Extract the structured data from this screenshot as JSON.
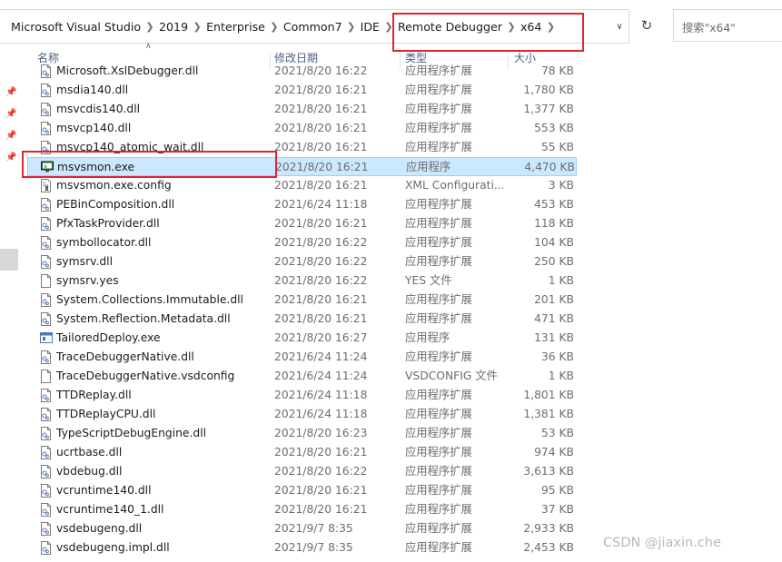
{
  "address": {
    "crumbs": [
      "Microsoft Visual Studio",
      "2019",
      "Enterprise",
      "Common7",
      "IDE",
      "Remote Debugger",
      "x64"
    ]
  },
  "search": {
    "placeholder": "搜索\"x64\""
  },
  "columns": {
    "name": "名称",
    "date": "修改日期",
    "type": "类型",
    "size": "大小"
  },
  "files": [
    {
      "name": "Microsoft.XslDebugger.dll",
      "date": "2021/8/20 16:22",
      "type": "应用程序扩展",
      "size": "78 KB",
      "icon": "dll-icon"
    },
    {
      "name": "msdia140.dll",
      "date": "2021/8/20 16:21",
      "type": "应用程序扩展",
      "size": "1,780 KB",
      "icon": "dll-icon"
    },
    {
      "name": "msvcdis140.dll",
      "date": "2021/8/20 16:21",
      "type": "应用程序扩展",
      "size": "1,377 KB",
      "icon": "dll-icon"
    },
    {
      "name": "msvcp140.dll",
      "date": "2021/8/20 16:21",
      "type": "应用程序扩展",
      "size": "553 KB",
      "icon": "dll-icon"
    },
    {
      "name": "msvcp140_atomic_wait.dll",
      "date": "2021/8/20 16:21",
      "type": "应用程序扩展",
      "size": "55 KB",
      "icon": "dll-icon"
    },
    {
      "name": "msvsmon.exe",
      "date": "2021/8/20 16:21",
      "type": "应用程序",
      "size": "4,470 KB",
      "icon": "monitor-exe-icon",
      "selected": true
    },
    {
      "name": "msvsmon.exe.config",
      "date": "2021/8/20 16:21",
      "type": "XML Configurati...",
      "size": "3 KB",
      "icon": "config-icon"
    },
    {
      "name": "PEBinComposition.dll",
      "date": "2021/6/24 11:18",
      "type": "应用程序扩展",
      "size": "453 KB",
      "icon": "dll-icon"
    },
    {
      "name": "PfxTaskProvider.dll",
      "date": "2021/8/20 16:21",
      "type": "应用程序扩展",
      "size": "118 KB",
      "icon": "dll-icon"
    },
    {
      "name": "symbollocator.dll",
      "date": "2021/8/20 16:22",
      "type": "应用程序扩展",
      "size": "104 KB",
      "icon": "dll-icon"
    },
    {
      "name": "symsrv.dll",
      "date": "2021/8/20 16:22",
      "type": "应用程序扩展",
      "size": "250 KB",
      "icon": "dll-icon"
    },
    {
      "name": "symsrv.yes",
      "date": "2021/8/20 16:22",
      "type": "YES 文件",
      "size": "1 KB",
      "icon": "file-icon"
    },
    {
      "name": "System.Collections.Immutable.dll",
      "date": "2021/8/20 16:21",
      "type": "应用程序扩展",
      "size": "201 KB",
      "icon": "dll-icon"
    },
    {
      "name": "System.Reflection.Metadata.dll",
      "date": "2021/8/20 16:21",
      "type": "应用程序扩展",
      "size": "471 KB",
      "icon": "dll-icon"
    },
    {
      "name": "TailoredDeploy.exe",
      "date": "2021/8/20 16:27",
      "type": "应用程序",
      "size": "131 KB",
      "icon": "app-exe-icon"
    },
    {
      "name": "TraceDebuggerNative.dll",
      "date": "2021/6/24 11:24",
      "type": "应用程序扩展",
      "size": "36 KB",
      "icon": "dll-icon"
    },
    {
      "name": "TraceDebuggerNative.vsdconfig",
      "date": "2021/6/24 11:24",
      "type": "VSDCONFIG 文件",
      "size": "1 KB",
      "icon": "file-icon"
    },
    {
      "name": "TTDReplay.dll",
      "date": "2021/6/24 11:18",
      "type": "应用程序扩展",
      "size": "1,801 KB",
      "icon": "dll-icon"
    },
    {
      "name": "TTDReplayCPU.dll",
      "date": "2021/6/24 11:18",
      "type": "应用程序扩展",
      "size": "1,381 KB",
      "icon": "dll-icon"
    },
    {
      "name": "TypeScriptDebugEngine.dll",
      "date": "2021/8/20 16:23",
      "type": "应用程序扩展",
      "size": "53 KB",
      "icon": "dll-icon"
    },
    {
      "name": "ucrtbase.dll",
      "date": "2021/8/20 16:21",
      "type": "应用程序扩展",
      "size": "974 KB",
      "icon": "dll-icon"
    },
    {
      "name": "vbdebug.dll",
      "date": "2021/8/20 16:22",
      "type": "应用程序扩展",
      "size": "3,613 KB",
      "icon": "dll-icon"
    },
    {
      "name": "vcruntime140.dll",
      "date": "2021/8/20 16:21",
      "type": "应用程序扩展",
      "size": "95 KB",
      "icon": "dll-icon"
    },
    {
      "name": "vcruntime140_1.dll",
      "date": "2021/8/20 16:21",
      "type": "应用程序扩展",
      "size": "37 KB",
      "icon": "dll-icon"
    },
    {
      "name": "vsdebugeng.dll",
      "date": "2021/9/7 8:35",
      "type": "应用程序扩展",
      "size": "2,933 KB",
      "icon": "dll-icon"
    },
    {
      "name": "vsdebugeng.impl.dll",
      "date": "2021/9/7 8:35",
      "type": "应用程序扩展",
      "size": "2,453 KB",
      "icon": "dll-icon"
    }
  ],
  "watermark": "CSDN @jiaxin.che",
  "colors": {
    "highlight_box": "#e1252e",
    "selection_bg": "#cce8ff",
    "selection_border": "#99d1ff"
  }
}
